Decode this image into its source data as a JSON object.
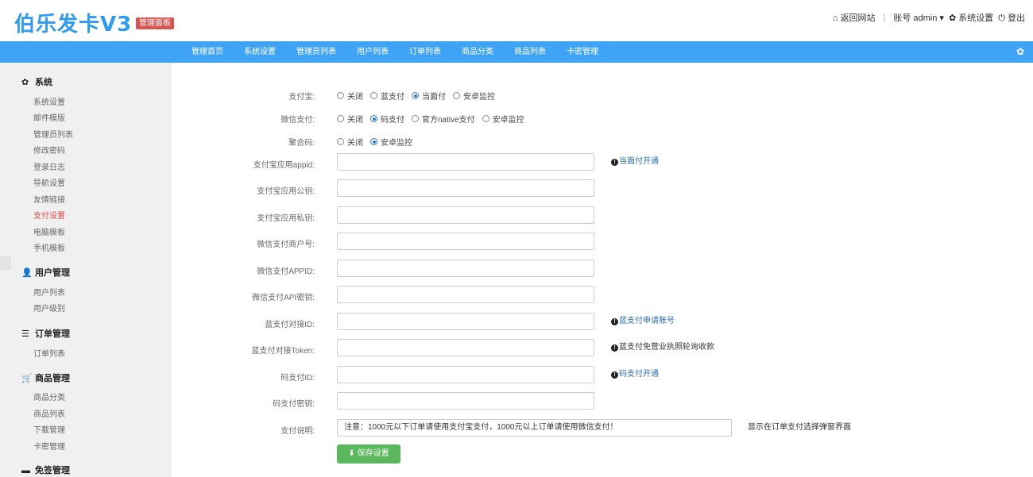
{
  "header": {
    "logo": "伯乐发卡V3",
    "badge": "管理面板",
    "back_site": "返回网站",
    "separator": "|",
    "account": "账号 admin",
    "settings": "系统设置",
    "logout": "登出"
  },
  "nav": {
    "items": [
      "管理首页",
      "系统设置",
      "管理员列表",
      "用户列表",
      "订单列表",
      "商品分类",
      "商品列表",
      "卡密管理"
    ]
  },
  "sidebar": {
    "groups": [
      {
        "title": "系统",
        "icon": "gear-icon",
        "items": [
          "系统设置",
          "邮件模版",
          "管理员列表",
          "修改密码",
          "登录日志",
          "导航设置",
          "友情链接",
          "支付设置",
          "电脑模板",
          "手机模板"
        ]
      },
      {
        "title": "用户管理",
        "icon": "user-icon",
        "items": [
          "用户列表",
          "用户级别"
        ]
      },
      {
        "title": "订单管理",
        "icon": "list-icon",
        "items": [
          "订单列表"
        ]
      },
      {
        "title": "商品管理",
        "icon": "cart-icon",
        "items": [
          "商品分类",
          "商品列表",
          "下载管理",
          "卡密管理"
        ]
      },
      {
        "title": "免签管理",
        "icon": "card-icon",
        "items": []
      }
    ],
    "active_item": "支付设置"
  },
  "form": {
    "alipay": {
      "label": "支付宝:",
      "options": [
        "关闭",
        "蓝支付",
        "当面付",
        "安卓监控"
      ],
      "selected": "当面付"
    },
    "wechat": {
      "label": "微信支付:",
      "options": [
        "关闭",
        "码支付",
        "官方native支付",
        "安卓监控"
      ],
      "selected": "码支付"
    },
    "juhe": {
      "label": "聚合码:",
      "options": [
        "关闭",
        "安卓监控"
      ],
      "selected": "安卓监控"
    },
    "fields": [
      {
        "label": "支付宝应用appid:",
        "value": "",
        "hint": "当面付开通",
        "hint_type": "link"
      },
      {
        "label": "支付宝应用公钥:",
        "value": ""
      },
      {
        "label": "支付宝应用私钥:",
        "value": ""
      },
      {
        "label": "微信支付商户号:",
        "value": ""
      },
      {
        "label": "微信支付APPID:",
        "value": ""
      },
      {
        "label": "微信支付API密钥:",
        "value": ""
      },
      {
        "label": "蓝支付对接ID:",
        "value": "",
        "hint": "蓝支付申请账号",
        "hint_type": "link"
      },
      {
        "label": "蓝支付对接Token:",
        "value": "",
        "hint": "蓝支付免营业执照轮询收款",
        "hint_type": "text"
      },
      {
        "label": "码支付ID:",
        "value": "",
        "hint": "码支付开通",
        "hint_type": "link"
      },
      {
        "label": "码支付密钥:",
        "value": ""
      }
    ],
    "description": {
      "label": "支付说明:",
      "value": "注意：1000元以下订单请使用支付宝支付，1000元以上订单请使用微信支付！",
      "hint": "显示在订单支付选择弹窗界面"
    },
    "save_label": "保存设置"
  },
  "colors": {
    "brand": "#2d9cf0",
    "nav": "#3fa4f5",
    "active": "#e04848",
    "save": "#5cb85c",
    "badge": "#d9534f"
  }
}
